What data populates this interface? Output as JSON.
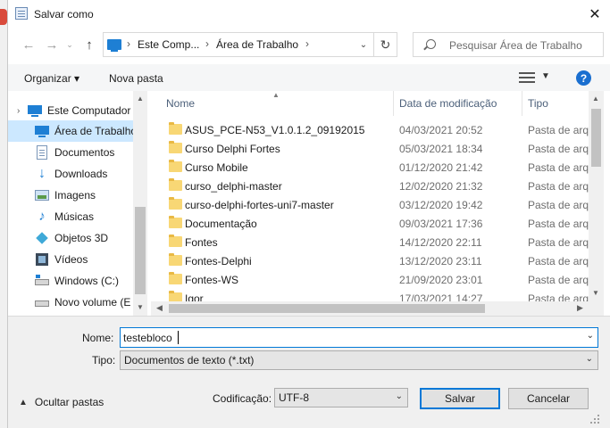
{
  "window": {
    "title": "Salvar como",
    "close_label": "✕"
  },
  "address_bar": {
    "segments": [
      "Este Comp...",
      "Área de Trabalho"
    ]
  },
  "search": {
    "placeholder": "Pesquisar Área de Trabalho"
  },
  "toolbar": {
    "organize_label": "Organizar ▾",
    "new_folder_label": "Nova pasta",
    "help_label": "?"
  },
  "nav_pane": {
    "items": [
      {
        "label": "Este Computador",
        "icon": "computer-icon",
        "selected": false,
        "expander": "›"
      },
      {
        "label": "Área de Trabalho",
        "icon": "desktop-icon",
        "selected": true
      },
      {
        "label": "Documentos",
        "icon": "documents-icon",
        "selected": false
      },
      {
        "label": "Downloads",
        "icon": "downloads-icon",
        "selected": false
      },
      {
        "label": "Imagens",
        "icon": "pictures-icon",
        "selected": false
      },
      {
        "label": "Músicas",
        "icon": "music-icon",
        "selected": false
      },
      {
        "label": "Objetos 3D",
        "icon": "3d-objects-icon",
        "selected": false
      },
      {
        "label": "Vídeos",
        "icon": "videos-icon",
        "selected": false
      },
      {
        "label": "Windows (C:)",
        "icon": "drive-icon",
        "selected": false
      },
      {
        "label": "Novo volume (E",
        "icon": "drive-icon",
        "selected": false
      }
    ]
  },
  "file_list": {
    "columns": {
      "name": "Nome",
      "date": "Data de modificação",
      "type": "Tipo"
    },
    "rows": [
      {
        "name": "ASUS_PCE-N53_V1.0.1.2_09192015",
        "date": "04/03/2021 20:52",
        "type": "Pasta de arquivos"
      },
      {
        "name": "Curso Delphi Fortes",
        "date": "05/03/2021 18:34",
        "type": "Pasta de arquivos"
      },
      {
        "name": "Curso Mobile",
        "date": "01/12/2020 21:42",
        "type": "Pasta de arquivos"
      },
      {
        "name": "curso_delphi-master",
        "date": "12/02/2020 21:32",
        "type": "Pasta de arquivos"
      },
      {
        "name": "curso-delphi-fortes-uni7-master",
        "date": "03/12/2020 19:42",
        "type": "Pasta de arquivos"
      },
      {
        "name": "Documentação",
        "date": "09/03/2021 17:36",
        "type": "Pasta de arquivos"
      },
      {
        "name": "Fontes",
        "date": "14/12/2020 22:11",
        "type": "Pasta de arquivos"
      },
      {
        "name": "Fontes-Delphi",
        "date": "13/12/2020 23:11",
        "type": "Pasta de arquivos"
      },
      {
        "name": "Fontes-WS",
        "date": "21/09/2020 23:01",
        "type": "Pasta de arquivos"
      },
      {
        "name": "Igor",
        "date": "17/03/2021 14:27",
        "type": "Pasta de arquivos"
      }
    ]
  },
  "form": {
    "name_label": "Nome:",
    "name_value": "testebloco",
    "type_label": "Tipo:",
    "type_value": "Documentos de texto (*.txt)",
    "hide_folders_label": "Ocultar pastas",
    "encoding_label": "Codificação:",
    "encoding_value": "UTF-8",
    "save_label": "Salvar",
    "cancel_label": "Cancelar"
  },
  "colors": {
    "accent": "#0078d7",
    "selected_bg": "#cce8ff",
    "folder": "#f8d775"
  }
}
